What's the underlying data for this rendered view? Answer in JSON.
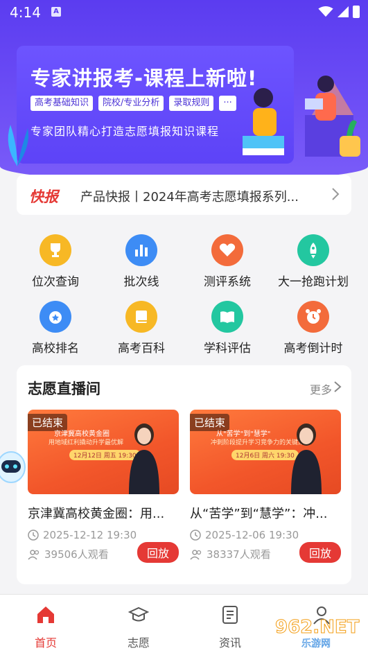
{
  "status": {
    "time": "4:14",
    "notif": "A"
  },
  "banner": {
    "title": "专家讲报考-课程上新啦!",
    "tags": [
      "高考基础知识",
      "院校/专业分析",
      "录取规则",
      "···"
    ],
    "subtitle": "专家团队精心打造志愿填报知识课程"
  },
  "ticker": {
    "label": "快报",
    "text": "产品快报丨2024年高考志愿填报系列..."
  },
  "grid": [
    {
      "label": "位次查询",
      "icon": "trophy-icon",
      "color": "#f7b825"
    },
    {
      "label": "批次线",
      "icon": "bar-chart-icon",
      "color": "#3d8cf5"
    },
    {
      "label": "测评系统",
      "icon": "heart-icon",
      "color": "#f36b3b"
    },
    {
      "label": "大一抢跑计划",
      "icon": "rocket-icon",
      "color": "#23c7a0"
    },
    {
      "label": "高校排名",
      "icon": "medal-icon",
      "color": "#3d8cf5"
    },
    {
      "label": "高考百科",
      "icon": "book-icon",
      "color": "#f7b825"
    },
    {
      "label": "学科评估",
      "icon": "open-book-icon",
      "color": "#23c7a0"
    },
    {
      "label": "高考倒计时",
      "icon": "alarm-clock-icon",
      "color": "#f36b3b"
    }
  ],
  "live": {
    "title": "志愿直播间",
    "more": "更多",
    "cards": [
      {
        "badge": "已结束",
        "thumb_line1": "京津冀高校黄金圈",
        "thumb_line2": "用地域红利撬动升学最优解",
        "thumb_date": "12月12日 周五 19:30",
        "name": "京津冀高校黄金圈：用...",
        "time": "2025-12-12 19:30",
        "views": "39506人观看",
        "replay": "回放"
      },
      {
        "badge": "已结束",
        "thumb_line1": "从\"苦学\"到\"慧学\"",
        "thumb_line2": "冲刺阶段提升学习竞争力的关键策略",
        "thumb_date": "12月6日 周六 19:30",
        "name": "从“苦学”到“慧学”：冲...",
        "time": "2025-12-06 19:30",
        "views": "38337人观看",
        "replay": "回放"
      }
    ]
  },
  "nav": [
    {
      "label": "首页",
      "icon": "home-icon",
      "active": true
    },
    {
      "label": "志愿",
      "icon": "graduation-cap-icon",
      "active": false
    },
    {
      "label": "资讯",
      "icon": "document-icon",
      "active": false
    },
    {
      "label": "",
      "icon": "user-icon",
      "active": false
    }
  ],
  "colors": {
    "brand": "#5b3cf0",
    "accent": "#e53935"
  },
  "watermark": "962.NET 乐游网"
}
